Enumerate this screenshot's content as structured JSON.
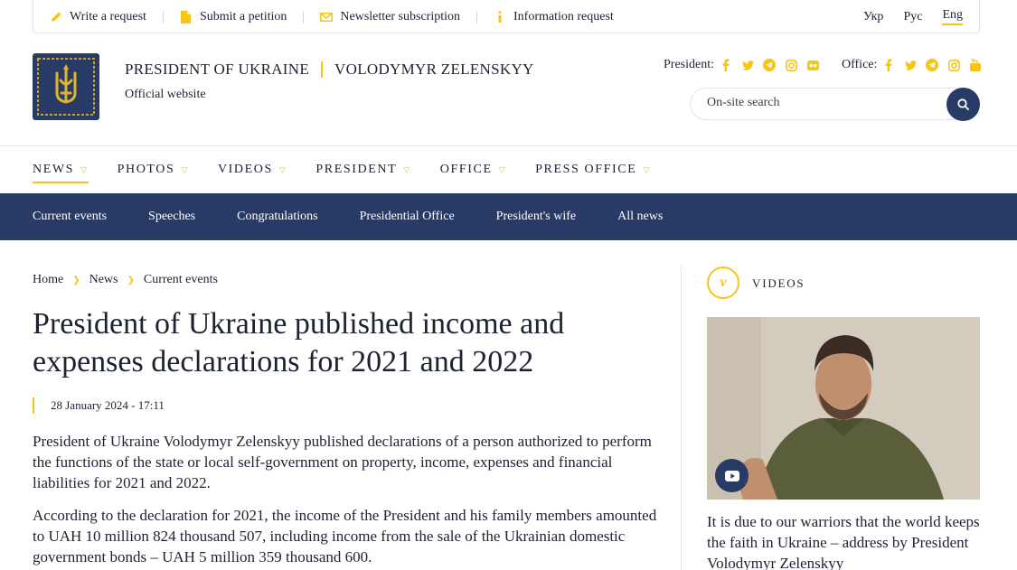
{
  "topbar": {
    "links": [
      {
        "label": "Write a request",
        "icon": "pencil-icon"
      },
      {
        "label": "Submit a petition",
        "icon": "document-icon"
      },
      {
        "label": "Newsletter subscription",
        "icon": "envelope-icon"
      },
      {
        "label": "Information request",
        "icon": "info-icon"
      }
    ],
    "languages": [
      "Укр",
      "Рус",
      "Eng"
    ],
    "active_language": "Eng"
  },
  "header": {
    "title": "PRESIDENT OF UKRAINE",
    "name": "VOLODYMYR ZELENSKYY",
    "subtitle": "Official website",
    "president_label": "President:",
    "office_label": "Office:",
    "president_socials": [
      "facebook-icon",
      "twitter-icon",
      "telegram-icon",
      "instagram-icon",
      "flickr-icon"
    ],
    "office_socials": [
      "facebook-icon",
      "twitter-icon",
      "telegram-icon",
      "instagram-icon",
      "youtube-icon"
    ],
    "search_placeholder": "On-site search"
  },
  "main_nav": [
    {
      "label": "NEWS",
      "active": true
    },
    {
      "label": "PHOTOS"
    },
    {
      "label": "VIDEOS"
    },
    {
      "label": "PRESIDENT"
    },
    {
      "label": "OFFICE"
    },
    {
      "label": "PRESS OFFICE"
    }
  ],
  "sub_nav": [
    "Current events",
    "Speeches",
    "Congratulations",
    "Presidential Office",
    "President's wife",
    "All news"
  ],
  "breadcrumb": [
    "Home",
    "News",
    "Current events"
  ],
  "article": {
    "title": "President of Ukraine published income and expenses declarations for 2021 and 2022",
    "date": "28 January 2024 - 17:11",
    "paragraphs": [
      "President of Ukraine Volodymyr Zelenskyy published declarations of a person authorized to perform the functions of the state or local self-government on property, income, expenses and financial liabilities for 2021 and 2022.",
      "According to the declaration for 2021, the income of the President and his family members amounted to UAH 10 million 824 thousand 507, including income from the sale of the Ukrainian domestic government bonds – UAH 5 million 359 thousand 600."
    ]
  },
  "sidebar": {
    "badge": "v",
    "section_label": "VIDEOS",
    "video_title": "It is due to our warriors that the world keeps the faith in Ukraine – address by President Volodymyr Zelenskyy"
  },
  "colors": {
    "accent": "#f5c518",
    "navy": "#283b66",
    "text": "#1d2233"
  }
}
